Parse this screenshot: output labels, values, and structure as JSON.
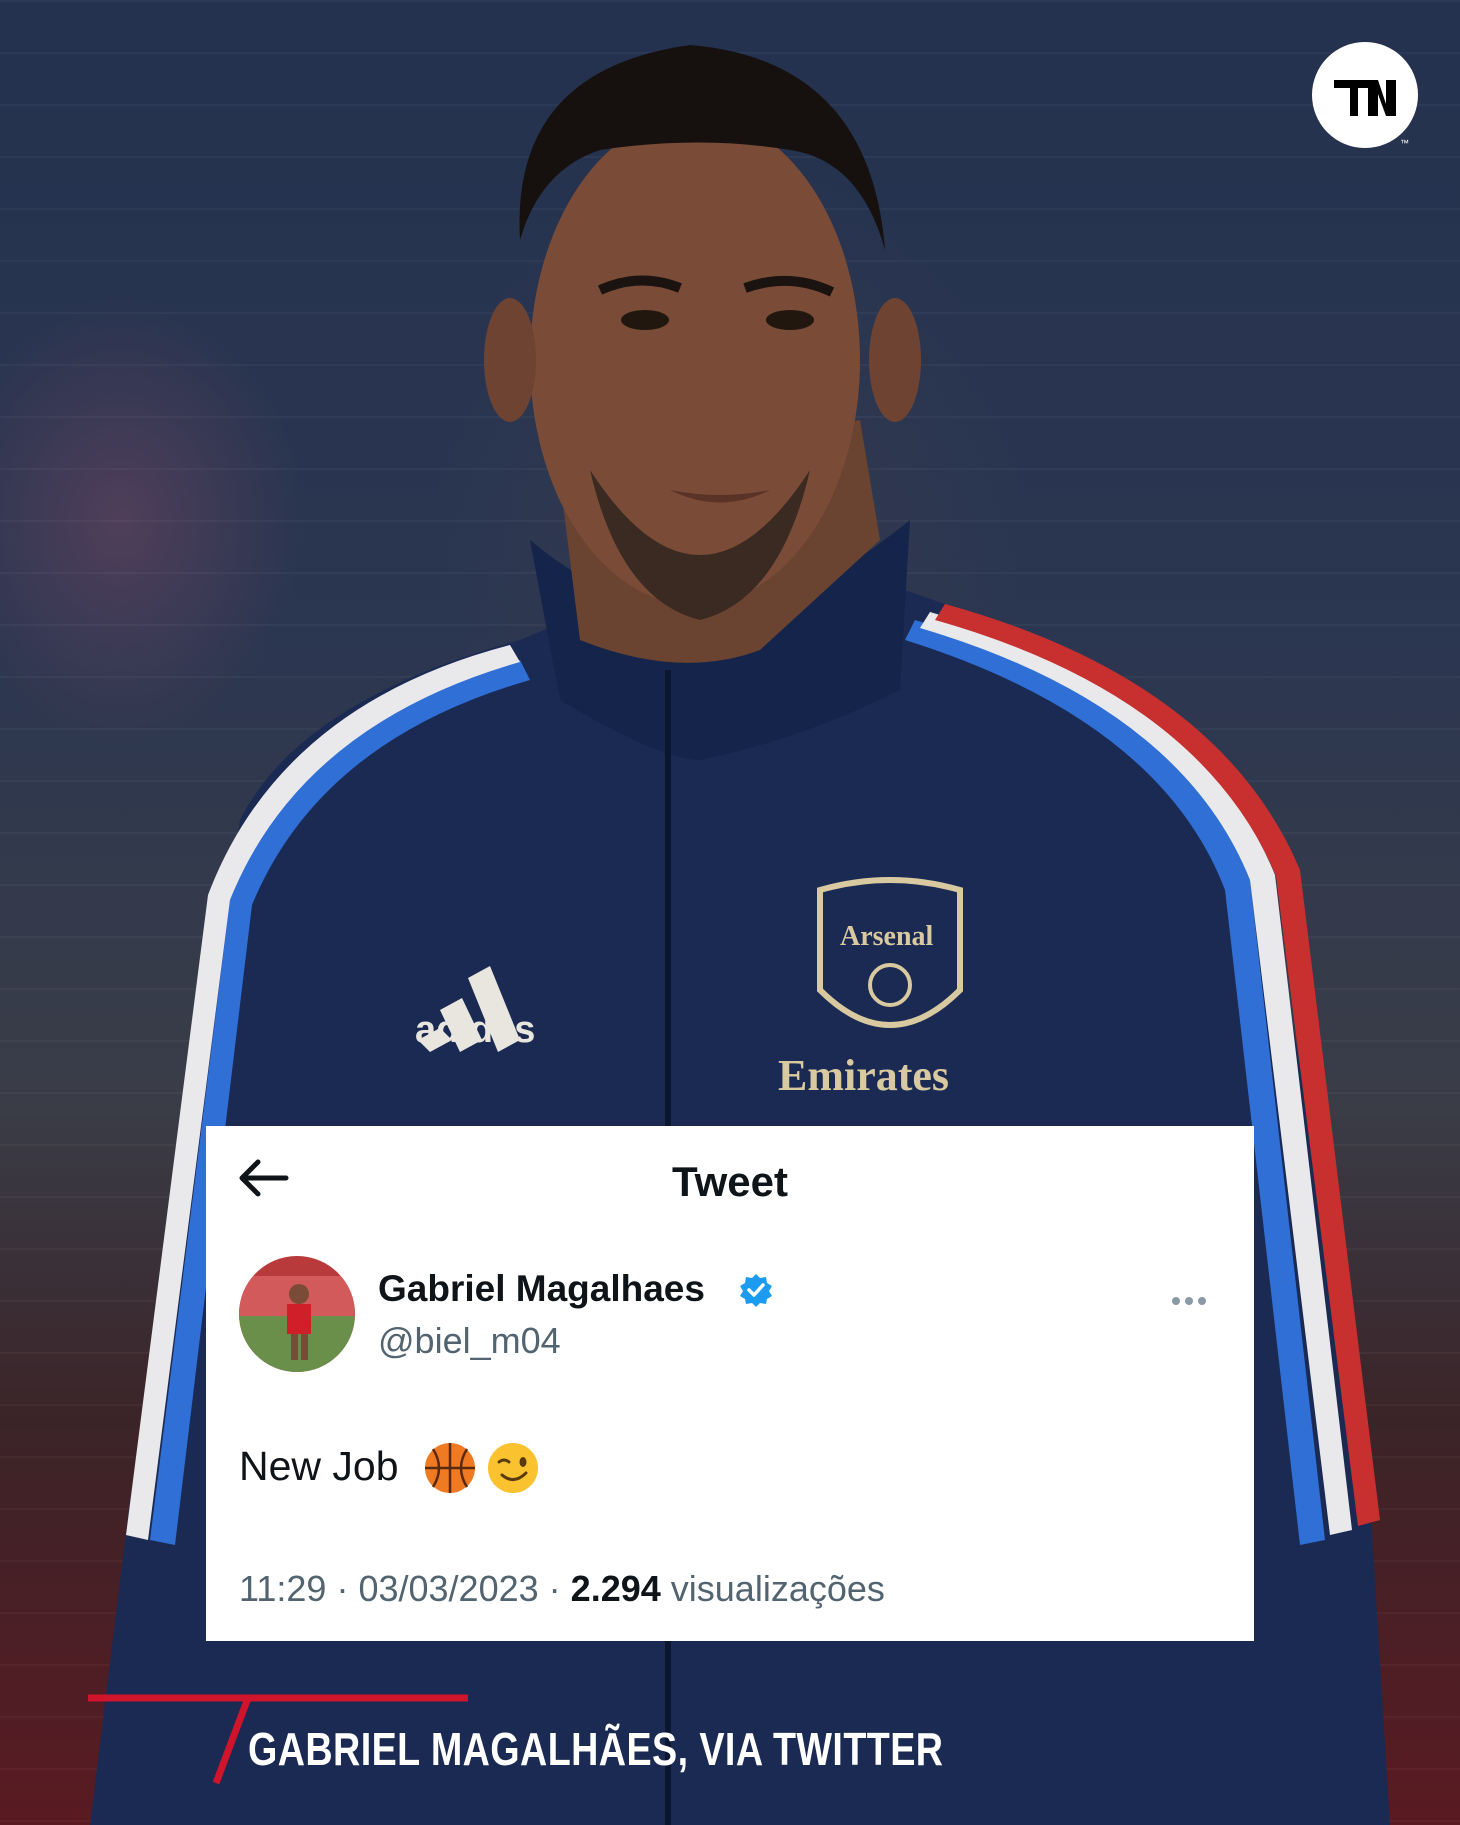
{
  "brand": {
    "logo": "tnt-sports-logo",
    "trademark": "™"
  },
  "tweet_view": {
    "header_title": "Tweet",
    "back_icon": "arrow-left-icon",
    "author": {
      "display_name": "Gabriel Magalhaes",
      "handle": "@biel_m04",
      "verified": true,
      "verified_color": "#1d9bf0"
    },
    "more_icon": "more-dots-icon",
    "text": "New Job",
    "emojis": [
      "basketball-emoji",
      "winking-face-emoji"
    ],
    "time": "11:29",
    "separator": "·",
    "date": "03/03/2023",
    "views_count": "2.294",
    "views_label": "visualizações"
  },
  "caption": {
    "text": "GABRIEL MAGALHÃES, VIA TWITTER",
    "accent_color": "#d0142c"
  }
}
